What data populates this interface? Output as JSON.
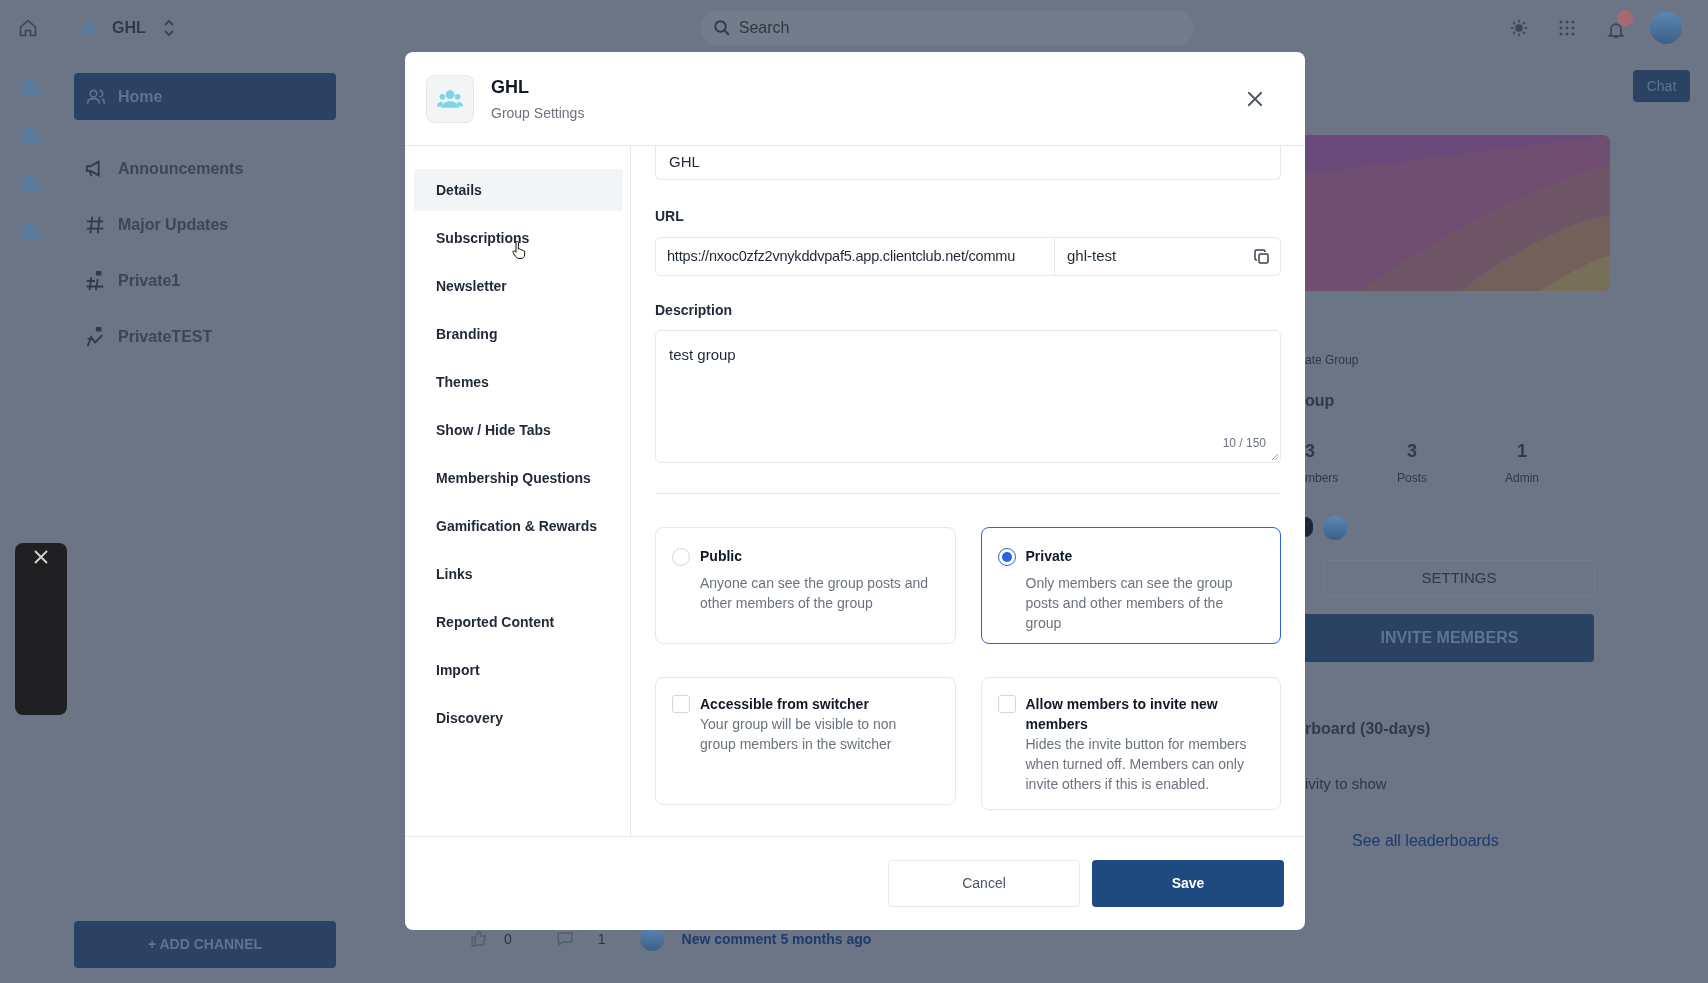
{
  "top_bar": {
    "group_name": "GHL",
    "search": {
      "placeholder": "Search"
    }
  },
  "sidebar": {
    "home": "Home",
    "channels": [
      {
        "label": "Announcements",
        "kind": "megaphone"
      },
      {
        "label": "Major Updates",
        "kind": "hash"
      },
      {
        "label": "Private1",
        "kind": "private-hash"
      },
      {
        "label": "PrivateTEST",
        "kind": "private-other"
      }
    ],
    "add_channel": "+ ADD CHANNEL"
  },
  "chat_button": "Chat",
  "group_panel": {
    "type_label": "ate Group",
    "name": "oup",
    "stats": [
      {
        "value": "3",
        "label": "mbers"
      },
      {
        "value": "3",
        "label": "Posts"
      },
      {
        "value": "1",
        "label": "Admin"
      }
    ],
    "settings": "SETTINGS",
    "invite": "INVITE MEMBERS",
    "leaderboard_title": "rboard (30-days)",
    "empty_text": "ivity to show",
    "see_all": "See all leaderboards"
  },
  "post_footer": {
    "likes": "0",
    "comments": "1",
    "activity": "New comment 5 months ago"
  },
  "modal": {
    "title": "GHL",
    "subtitle": "Group Settings",
    "nav": [
      {
        "label": "Details",
        "selected": true
      },
      {
        "label": "Subscriptions",
        "selected": false
      },
      {
        "label": "Newsletter",
        "selected": false
      },
      {
        "label": "Branding",
        "selected": false
      },
      {
        "label": "Themes",
        "selected": false
      },
      {
        "label": "Show / Hide Tabs",
        "selected": false
      },
      {
        "label": "Membership Questions",
        "selected": false
      },
      {
        "label": "Gamification & Rewards",
        "selected": false
      },
      {
        "label": "Links",
        "selected": false
      },
      {
        "label": "Reported Content",
        "selected": false
      },
      {
        "label": "Import",
        "selected": false
      },
      {
        "label": "Discovery",
        "selected": false
      }
    ],
    "name_value": "GHL",
    "url": {
      "label": "URL",
      "base": "https://nxoc0zfz2vnykddvpaf5.app.clientclub.net/commu",
      "slug": "ghl-test"
    },
    "description": {
      "label": "Description",
      "value": "test group",
      "counter": "10 / 150"
    },
    "privacy": [
      {
        "title": "Public",
        "text": "Anyone can see the group posts and other members of the group",
        "selected": false
      },
      {
        "title": "Private",
        "text": "Only members can see the group posts and other members of the group",
        "selected": true
      }
    ],
    "options": [
      {
        "title": "Accessible from switcher",
        "text": "Your group will be visible to non group members in the switcher",
        "checked": false
      },
      {
        "title": "Allow members to invite new members",
        "text": "Hides the invite button for members when turned off. Members can only invite others if this is enabled.",
        "checked": false
      }
    ],
    "buttons": {
      "cancel": "Cancel",
      "save": "Save"
    }
  }
}
